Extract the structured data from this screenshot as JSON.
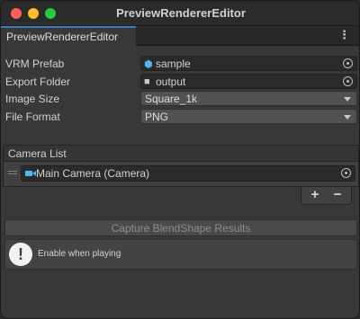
{
  "window": {
    "title": "PreviewRendererEditor"
  },
  "tab": {
    "label": "PreviewRendererEditor",
    "menu_icon": "kebab-menu-icon"
  },
  "fields": {
    "vrm_prefab": {
      "label": "VRM Prefab",
      "value": "sample",
      "icon": "prefab-cube-icon",
      "icon_color": "#4fb6e8"
    },
    "export_folder": {
      "label": "Export Folder",
      "value": "output",
      "icon": "folder-icon"
    },
    "image_size": {
      "label": "Image Size",
      "value": "Square_1k"
    },
    "file_format": {
      "label": "File Format",
      "value": "PNG"
    }
  },
  "camera_list": {
    "header": "Camera List",
    "items": [
      {
        "value": "Main Camera (Camera)",
        "icon": "camera-icon",
        "icon_color": "#52b8e6"
      }
    ],
    "add_label": "+",
    "remove_label": "−"
  },
  "capture_button": {
    "label": "Capture BlendShape Results"
  },
  "help": {
    "text": "Enable when playing",
    "icon": "warning-icon",
    "icon_glyph": "!"
  },
  "colors": {
    "accent": "#3a79bb",
    "background": "#383838",
    "close": "#fe5f57",
    "minimize": "#febc2e",
    "maximize": "#28c840"
  }
}
